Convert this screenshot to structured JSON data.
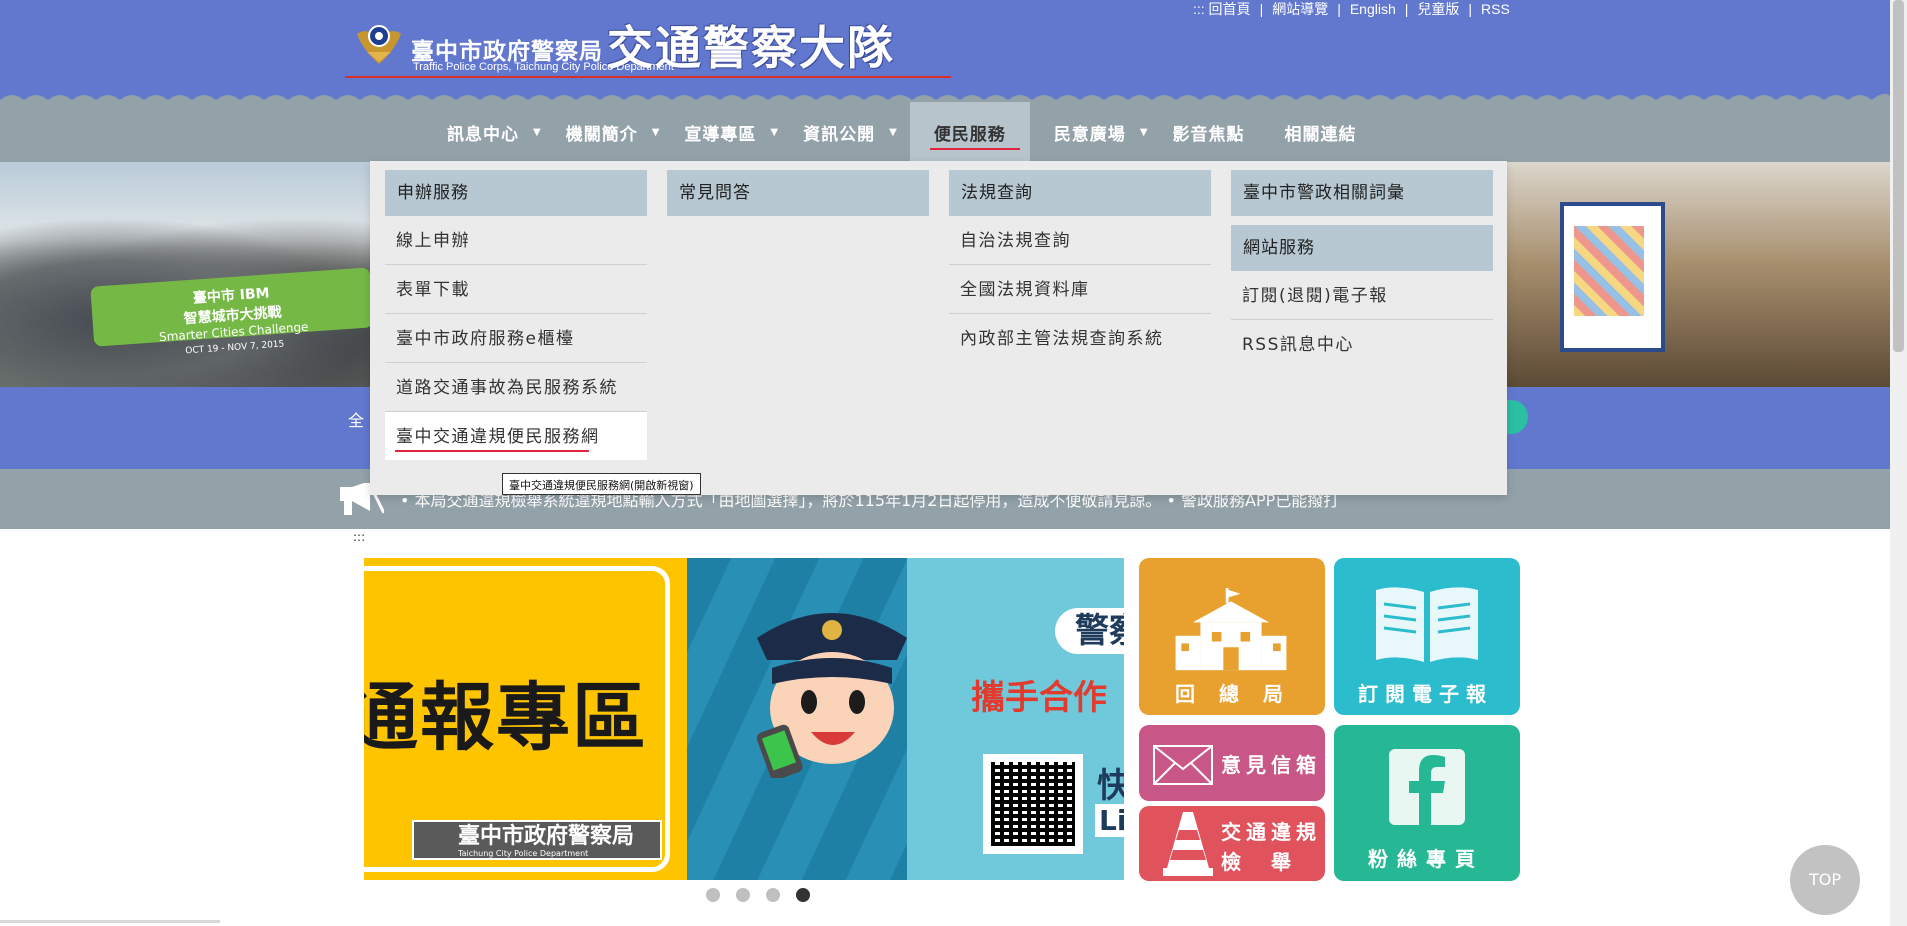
{
  "header": {
    "logo_zh": "臺中市政府警察局",
    "logo_big": "交通警察大隊",
    "logo_en": "Traffic Police Corps, Taichung City Police Department",
    "top_links": [
      {
        "label": "::: 回首頁"
      },
      {
        "label": "網站導覽"
      },
      {
        "label": "English"
      },
      {
        "label": "兒童版"
      },
      {
        "label": "RSS"
      }
    ]
  },
  "nav": {
    "items": [
      {
        "label": "訊息中心",
        "has_caret": true
      },
      {
        "label": "機關簡介",
        "has_caret": true
      },
      {
        "label": "宣導專區",
        "has_caret": true
      },
      {
        "label": "資訊公開",
        "has_caret": true
      },
      {
        "label": "便民服務",
        "has_caret": false,
        "active": true
      },
      {
        "label": "民意廣場",
        "has_caret": true
      },
      {
        "label": "影音焦點",
        "has_caret": false
      },
      {
        "label": "相關連結",
        "has_caret": false
      }
    ]
  },
  "mega_menu": {
    "col1": {
      "head": "申辦服務",
      "links": [
        "線上申辦",
        "表單下載",
        "臺中市政府服務e櫃檯",
        "道路交通事故為民服務系統",
        "臺中交通違規便民服務網"
      ]
    },
    "col2": {
      "head": "常見問答"
    },
    "col3": {
      "head": "法規查詢",
      "links": [
        "自治法規查詢",
        "全國法規資料庫",
        "內政部主管法規查詢系統"
      ]
    },
    "col4": {
      "head": "臺中市警政相關詞彙",
      "head2": "網站服務",
      "links": [
        "訂閱(退閱)電子報",
        "RSS訊息中心"
      ]
    },
    "tooltip": "臺中交通違規便民服務網(開啟新視窗)"
  },
  "banner": {
    "sign_line1": "臺中市 IBM",
    "sign_line2": "智慧城市大挑戰",
    "sign_line3": "Smarter Cities Challenge",
    "sign_line4": "OCT 19 - NOV 7, 2015"
  },
  "search": {
    "label_partial": "全"
  },
  "marquee": {
    "text": "• 本局交通違規檢舉系統違規地點輸入方式「由地圖選擇」，將於115年1月2日起停用，造成不便敬請見諒。 • 警政服務APP已能撥打"
  },
  "accesskey": ":::",
  "carousel": {
    "yellow_text": "通報專區",
    "seal_text": "臺中市政府警察局",
    "seal_en": "Taichung City Police Department",
    "blue_pill": "警察",
    "blue_red": "攜手合作",
    "blue_kuai": "快",
    "blue_li": "Li",
    "dots": 4,
    "active_dot": 3
  },
  "tiles": {
    "hq": "回總局",
    "news": "訂閱電子報",
    "mail": "意見信箱",
    "report_line1": "交通違規",
    "report_line2": "檢　舉",
    "fb": "粉絲專頁"
  },
  "top_button": "TOP",
  "colors": {
    "header_blue": "#6278cf",
    "nav_gray": "#93a1a9",
    "active_red": "#e0263e",
    "tile_orange": "#e8a02f",
    "tile_cyan": "#2bbcce",
    "tile_pink": "#c85686",
    "tile_red": "#e0535d",
    "tile_green": "#26b894"
  }
}
